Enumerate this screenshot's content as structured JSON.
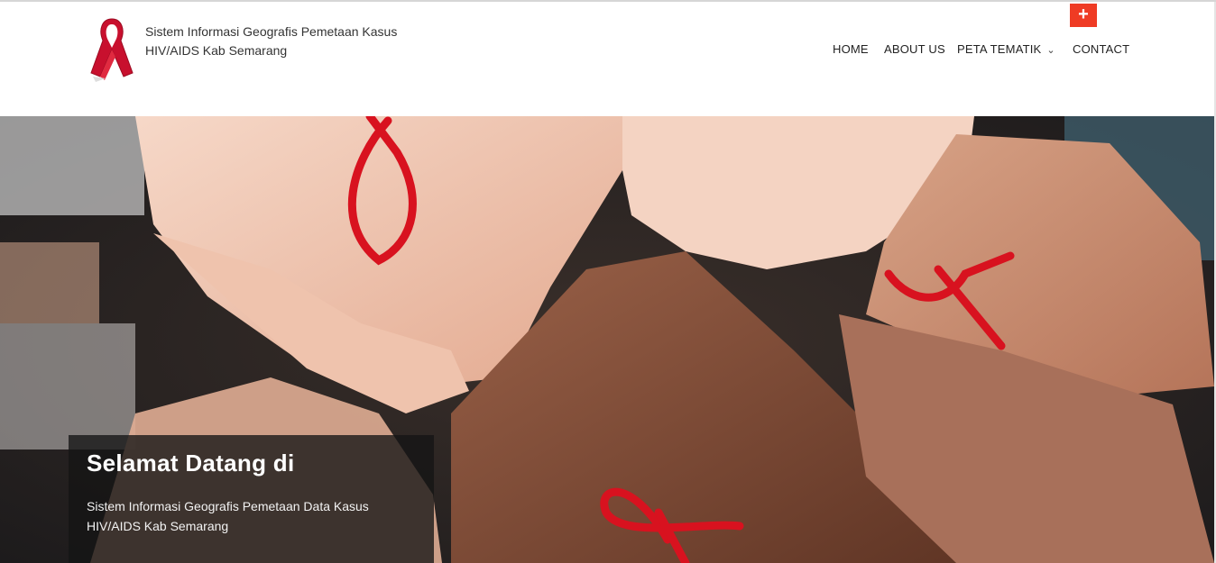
{
  "header": {
    "site_title": "Sistem Informasi Geografis Pemetaan Kasus HIV/AIDS Kab Semarang",
    "accent_color": "#ef3b24",
    "toggle_label": "+"
  },
  "nav": {
    "items": [
      {
        "label": "HOME"
      },
      {
        "label": "ABOUT US"
      },
      {
        "label": "PETA TEMATIK",
        "has_dropdown": true
      },
      {
        "label": "CONTACT"
      }
    ]
  },
  "hero": {
    "image": "hands-with-red-ribbons",
    "welcome_title": "Selamat Datang di",
    "welcome_text": "Sistem Informasi Geografis Pemetaan Data Kasus HIV/AIDS Kab Semarang"
  },
  "icons": {
    "logo": "red-ribbon-logo-icon",
    "dropdown": "chevron-down-icon",
    "toggle": "plus-icon"
  }
}
